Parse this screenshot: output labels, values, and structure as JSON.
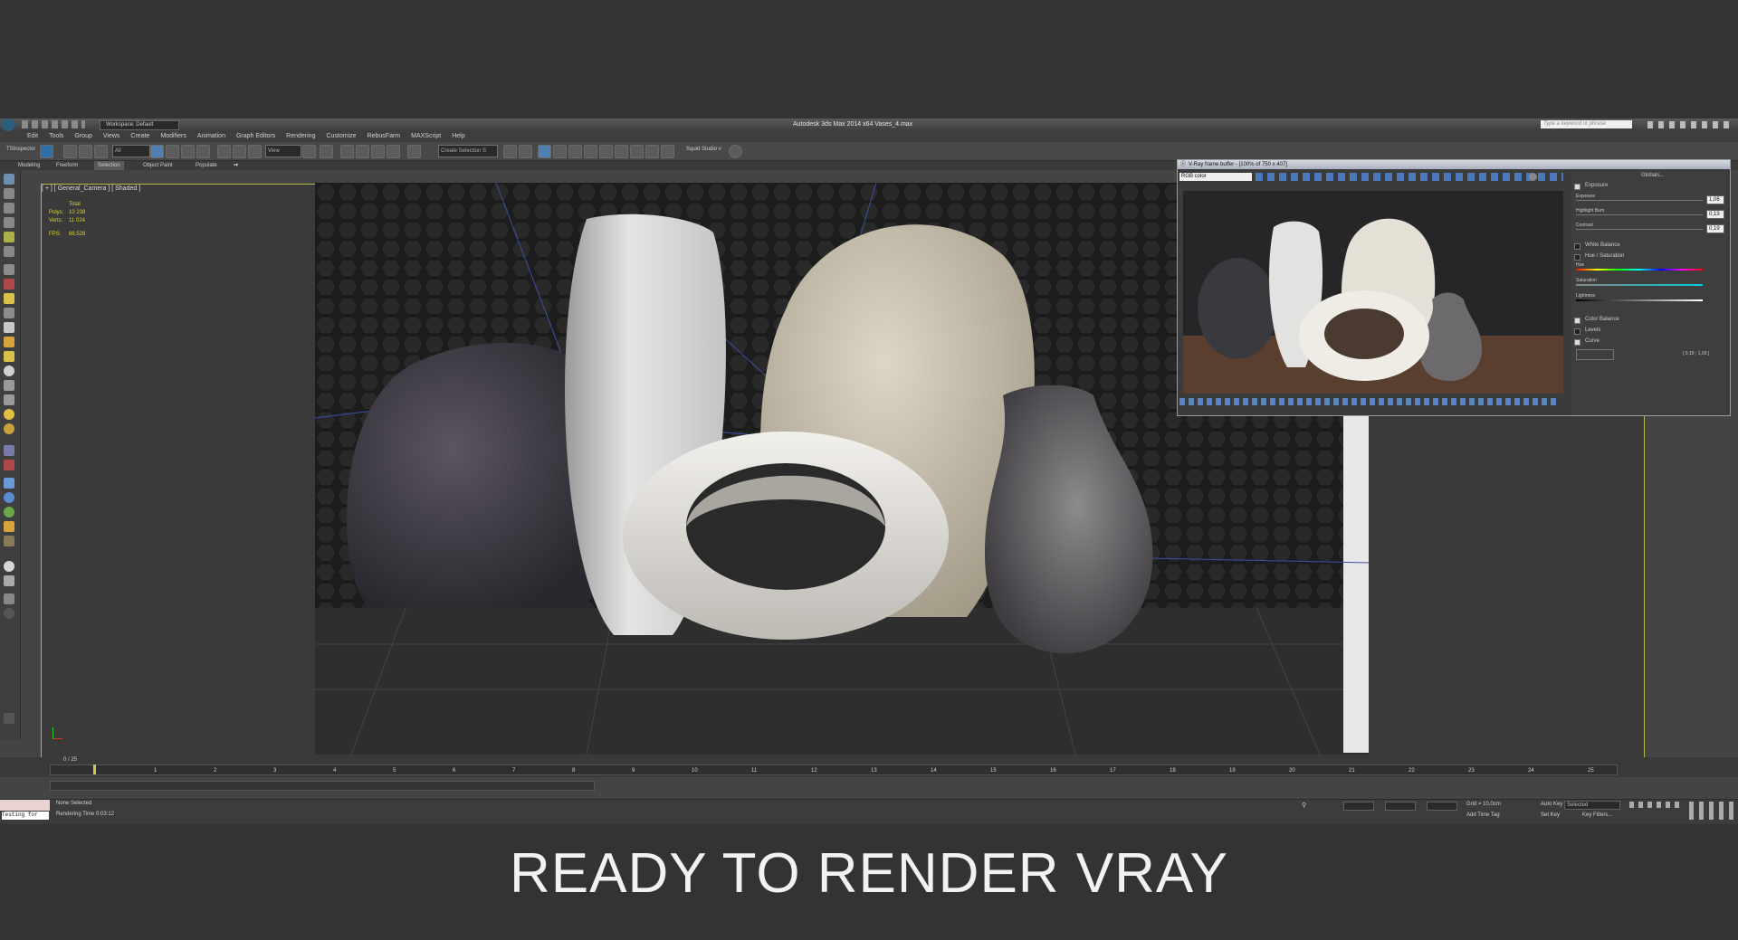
{
  "window": {
    "title": "Autodesk 3ds Max 2014 x64     Vases_4.max",
    "workspace": "Workspace: Default",
    "search_placeholder": "Type a keyword or phrase"
  },
  "menu": [
    "Edit",
    "Tools",
    "Group",
    "Views",
    "Create",
    "Modifiers",
    "Animation",
    "Graph Editors",
    "Rendering",
    "Customize",
    "RebusFarm",
    "MAXScript",
    "Help"
  ],
  "toolbar": {
    "inspector": "TSInspector",
    "filter": "All",
    "view": "View",
    "selection_set": "Create Selection S",
    "squid": "Squid Studio v"
  },
  "ribbon_tabs": [
    "Modeling",
    "Freeform",
    "Selection",
    "Object Paint",
    "Populate"
  ],
  "viewport": {
    "label": "[ + ] [ General_Camera ] [ Shaded ]",
    "stats": {
      "total_label": "Total",
      "polys_label": "Polys:",
      "polys": "10 238",
      "verts_label": "Verts:",
      "verts": "11 024",
      "fps_label": "FPS:",
      "fps": "88,528"
    }
  },
  "timeline": {
    "frame": "0 / 25",
    "ticks": [
      "1",
      "2",
      "3",
      "4",
      "5",
      "6",
      "7",
      "8",
      "9",
      "10",
      "11",
      "12",
      "13",
      "14",
      "15",
      "16",
      "17",
      "18",
      "19",
      "20",
      "21",
      "22",
      "23",
      "24",
      "25"
    ]
  },
  "status": {
    "testing": "Testing for",
    "selection": "None Selected",
    "rendering_time": "Rendering Time  0:03:12",
    "grid": "Grid = 10,0cm",
    "add_time_tag": "Add Time Tag",
    "auto_key": "Auto Key",
    "auto_key_value": "Selected",
    "set_key": "Set Key",
    "key_filters": "Key Filters..."
  },
  "vfb": {
    "title": "V-Ray frame buffer - [100% of 750 x 407]",
    "channel": "RGB color",
    "panel_title": "Globals...",
    "sections": {
      "exposure": "Exposure",
      "exposure_label": "Exposure",
      "exposure_value": "1,06",
      "highlight_label": "Highlight Burn",
      "highlight_value": "0,13",
      "contrast_label": "Contrast",
      "contrast_value": "0,19",
      "white_balance": "White Balance",
      "hue_saturation": "Hue / Saturation",
      "hue_label": "Hue",
      "saturation_label": "Saturation",
      "lightness_label": "Lightness",
      "color_balance": "Color Balance",
      "levels": "Levels",
      "curve": "Curve",
      "curve_coords": "[ 0,19 ; 1,03 ]"
    }
  },
  "caption": "READY TO RENDER VRAY"
}
